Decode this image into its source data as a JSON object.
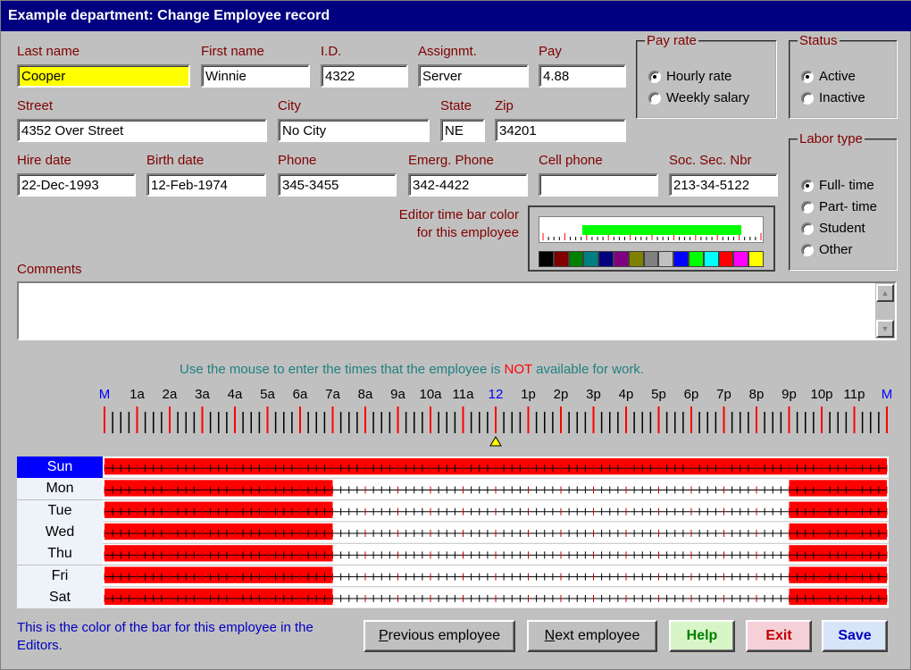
{
  "window": {
    "title": "Example department: Change Employee record"
  },
  "fields": {
    "last_name": {
      "label": "Last name",
      "value": "Cooper"
    },
    "first_name": {
      "label": "First name",
      "value": "Winnie"
    },
    "id": {
      "label": "I.D.",
      "value": "4322"
    },
    "assignment": {
      "label": "Assignmt.",
      "value": "Server"
    },
    "pay": {
      "label": "Pay",
      "value": "4.88"
    },
    "street": {
      "label": "Street",
      "value": "4352 Over Street"
    },
    "city": {
      "label": "City",
      "value": "No City"
    },
    "state": {
      "label": "State",
      "value": "NE"
    },
    "zip": {
      "label": "Zip",
      "value": "34201"
    },
    "hire_date": {
      "label": "Hire date",
      "value": "22-Dec-1993"
    },
    "birth_date": {
      "label": "Birth date",
      "value": "12-Feb-1974"
    },
    "phone": {
      "label": "Phone",
      "value": "345-3455"
    },
    "emerg_phone": {
      "label": "Emerg. Phone",
      "value": "342-4422"
    },
    "cell_phone": {
      "label": "Cell phone",
      "value": ""
    },
    "ssn": {
      "label": "Soc. Sec. Nbr",
      "value": "213-34-5122"
    },
    "comments": {
      "label": "Comments",
      "value": ""
    }
  },
  "pay_rate": {
    "title": "Pay rate",
    "options": [
      "Hourly rate",
      "Weekly salary"
    ],
    "selected": "Hourly rate"
  },
  "status": {
    "title": "Status",
    "options": [
      "Active",
      "Inactive"
    ],
    "selected": "Active"
  },
  "labor_type": {
    "title": "Labor type",
    "options": [
      "Full- time",
      "Part- time",
      "Student",
      "Other"
    ],
    "selected": "Full- time"
  },
  "editor_color": {
    "label_line1": "Editor time bar color",
    "label_line2": "for this employee",
    "current_color": "#00ff00",
    "palette": [
      "#000000",
      "#800000",
      "#008000",
      "#008080",
      "#000080",
      "#800080",
      "#808000",
      "#808080",
      "#c0c0c0",
      "#0000ff",
      "#00ff00",
      "#00ffff",
      "#ff0000",
      "#ff00ff",
      "#ffff00"
    ]
  },
  "instruction": {
    "part1": "Use the mouse to enter the times that the employee is ",
    "part2": "NOT",
    "part3": " available for work."
  },
  "hours": [
    "M",
    "1a",
    "2a",
    "3a",
    "4a",
    "5a",
    "6a",
    "7a",
    "8a",
    "9a",
    "10a",
    "11a",
    "12",
    "1p",
    "2p",
    "3p",
    "4p",
    "5p",
    "6p",
    "7p",
    "8p",
    "9p",
    "10p",
    "11p",
    "M"
  ],
  "schedule": {
    "selected_day": "Sun",
    "rows": [
      {
        "day": "Sun",
        "unavailable": [
          [
            0,
            24
          ]
        ]
      },
      {
        "day": "Mon",
        "unavailable": [
          [
            0,
            7
          ],
          [
            21,
            24
          ]
        ]
      },
      {
        "day": "Tue",
        "unavailable": [
          [
            0,
            7
          ],
          [
            21,
            24
          ]
        ]
      },
      {
        "day": "Wed",
        "unavailable": [
          [
            0,
            7
          ],
          [
            21,
            24
          ]
        ]
      },
      {
        "day": "Thu",
        "unavailable": [
          [
            0,
            7
          ],
          [
            21,
            24
          ]
        ]
      },
      {
        "day": "Fri",
        "unavailable": [
          [
            0,
            7
          ],
          [
            21,
            24
          ]
        ]
      },
      {
        "day": "Sat",
        "unavailable": [
          [
            0,
            7
          ],
          [
            21,
            24
          ]
        ]
      }
    ]
  },
  "footer_note": {
    "line1": "This is the color of the bar for this employee in the",
    "line2": "Editors."
  },
  "buttons": {
    "previous": {
      "prefix": "P",
      "rest": "revious employee"
    },
    "next": {
      "prefix": "N",
      "rest": "ext employee"
    },
    "help": {
      "label": "Help"
    },
    "exit": {
      "label": "Exit"
    },
    "save": {
      "label": "Save"
    }
  },
  "colors": {
    "title_bg": "#000080",
    "label": "#800000",
    "bar": "#ff0000",
    "help_bg": "#d8f5c8",
    "exit_bg": "#f5d0d8",
    "save_bg": "#d8e4f8"
  }
}
